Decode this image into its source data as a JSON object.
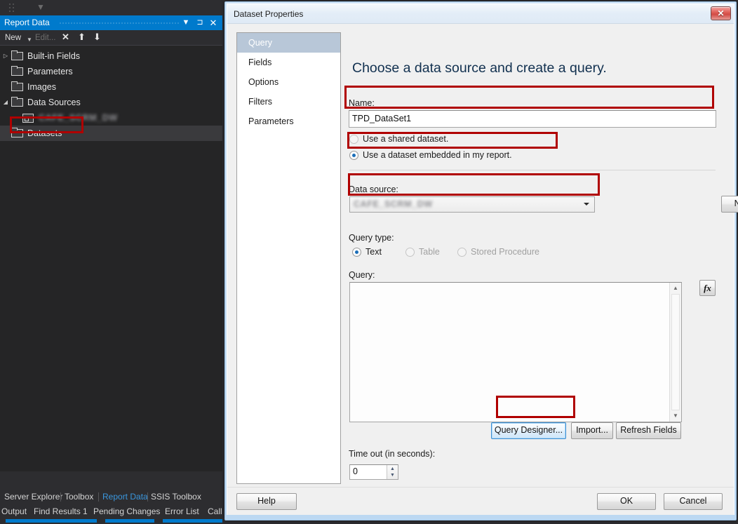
{
  "ide": {
    "quick_access_glyph": "▼",
    "panel": {
      "title": "Report Data",
      "title_buttons": [
        {
          "name": "dropdown",
          "glyph": "▼"
        },
        {
          "name": "pin",
          "glyph": "⊐"
        },
        {
          "name": "close",
          "glyph": "✕"
        }
      ],
      "toolbar": {
        "new_label": "New",
        "new_caret": "▼",
        "edit_label": "Edit...",
        "delete_glyph": "✕",
        "move_up_glyph": "⬆",
        "move_down_glyph": "⬇"
      },
      "tree": [
        {
          "label": "Built-in Fields",
          "icon": "folder-icon",
          "expander": "▷",
          "indent": 0,
          "selected": false
        },
        {
          "label": "Parameters",
          "icon": "folder-icon",
          "expander": "",
          "indent": 0,
          "selected": false
        },
        {
          "label": "Images",
          "icon": "folder-icon",
          "expander": "",
          "indent": 0,
          "selected": false
        },
        {
          "label": "Data Sources",
          "icon": "folder-icon",
          "expander": "◢",
          "indent": 0,
          "selected": false
        },
        {
          "label": "CAFE_SCRM_DW",
          "icon": "database-icon",
          "expander": "",
          "indent": 1,
          "selected": false,
          "redacted": true
        },
        {
          "label": "Datasets",
          "icon": "folder-icon",
          "expander": "",
          "indent": 0,
          "selected": true
        }
      ]
    },
    "bottom_tabs_row1": [
      {
        "label": "Server Explorer",
        "active": false
      },
      {
        "label": "Toolbox",
        "active": false
      },
      {
        "label": "Report Data",
        "active": true
      },
      {
        "label": "SSIS Toolbox",
        "active": false
      }
    ],
    "bottom_tabs_row2": [
      {
        "label": "Output",
        "active": false
      },
      {
        "label": "Find Results 1",
        "active": false
      },
      {
        "label": "Pending Changes",
        "active": false
      },
      {
        "label": "Error List",
        "active": false
      },
      {
        "label": "Call Hierarchy",
        "active": false
      }
    ]
  },
  "dialog": {
    "title": "Dataset Properties",
    "close_glyph": "✕",
    "nav": [
      {
        "label": "Query",
        "selected": true
      },
      {
        "label": "Fields",
        "selected": false
      },
      {
        "label": "Options",
        "selected": false
      },
      {
        "label": "Filters",
        "selected": false
      },
      {
        "label": "Parameters",
        "selected": false
      }
    ],
    "heading": "Choose a data source and create a query.",
    "name_label": "Name:",
    "name_value": "TPD_DataSet1",
    "dataset_source_options": [
      {
        "label": "Use a shared dataset.",
        "selected": false
      },
      {
        "label": "Use a dataset embedded in my report.",
        "selected": true
      }
    ],
    "data_source_label": "Data source:",
    "data_source_value": "CAFE_SCRM_DW",
    "data_source_redacted": true,
    "new_button": "New...",
    "query_type_label": "Query type:",
    "query_type_options": [
      {
        "label": "Text",
        "selected": true,
        "enabled": true
      },
      {
        "label": "Table",
        "selected": false,
        "enabled": false
      },
      {
        "label": "Stored Procedure",
        "selected": false,
        "enabled": false
      }
    ],
    "query_label": "Query:",
    "query_value": "",
    "expression_button": "fx",
    "scroll_up_glyph": "▲",
    "scroll_down_glyph": "▼",
    "action_buttons": [
      {
        "label": "Query Designer...",
        "focused": true
      },
      {
        "label": "Import...",
        "focused": false
      },
      {
        "label": "Refresh Fields",
        "focused": false
      }
    ],
    "timeout_label": "Time out (in seconds):",
    "timeout_value": "0",
    "spin_up_glyph": "▲",
    "spin_down_glyph": "▼",
    "footer": {
      "help": "Help",
      "ok": "OK",
      "cancel": "Cancel"
    }
  },
  "colors": {
    "ide_background": "#2d2d30",
    "panel_background": "#252526",
    "accent_blue": "#007acc",
    "active_tab_text": "#3a96dd",
    "annotation_red": "#b00000",
    "dialog_background": "#f0f0f0",
    "heading_blue": "#11304f",
    "nav_selected": "#b8c7d8"
  },
  "annotations": [
    {
      "name": "datasets-node-callout"
    },
    {
      "name": "name-field-callout"
    },
    {
      "name": "embedded-dataset-radio-callout"
    },
    {
      "name": "data-source-combo-callout"
    },
    {
      "name": "query-designer-button-callout"
    }
  ]
}
